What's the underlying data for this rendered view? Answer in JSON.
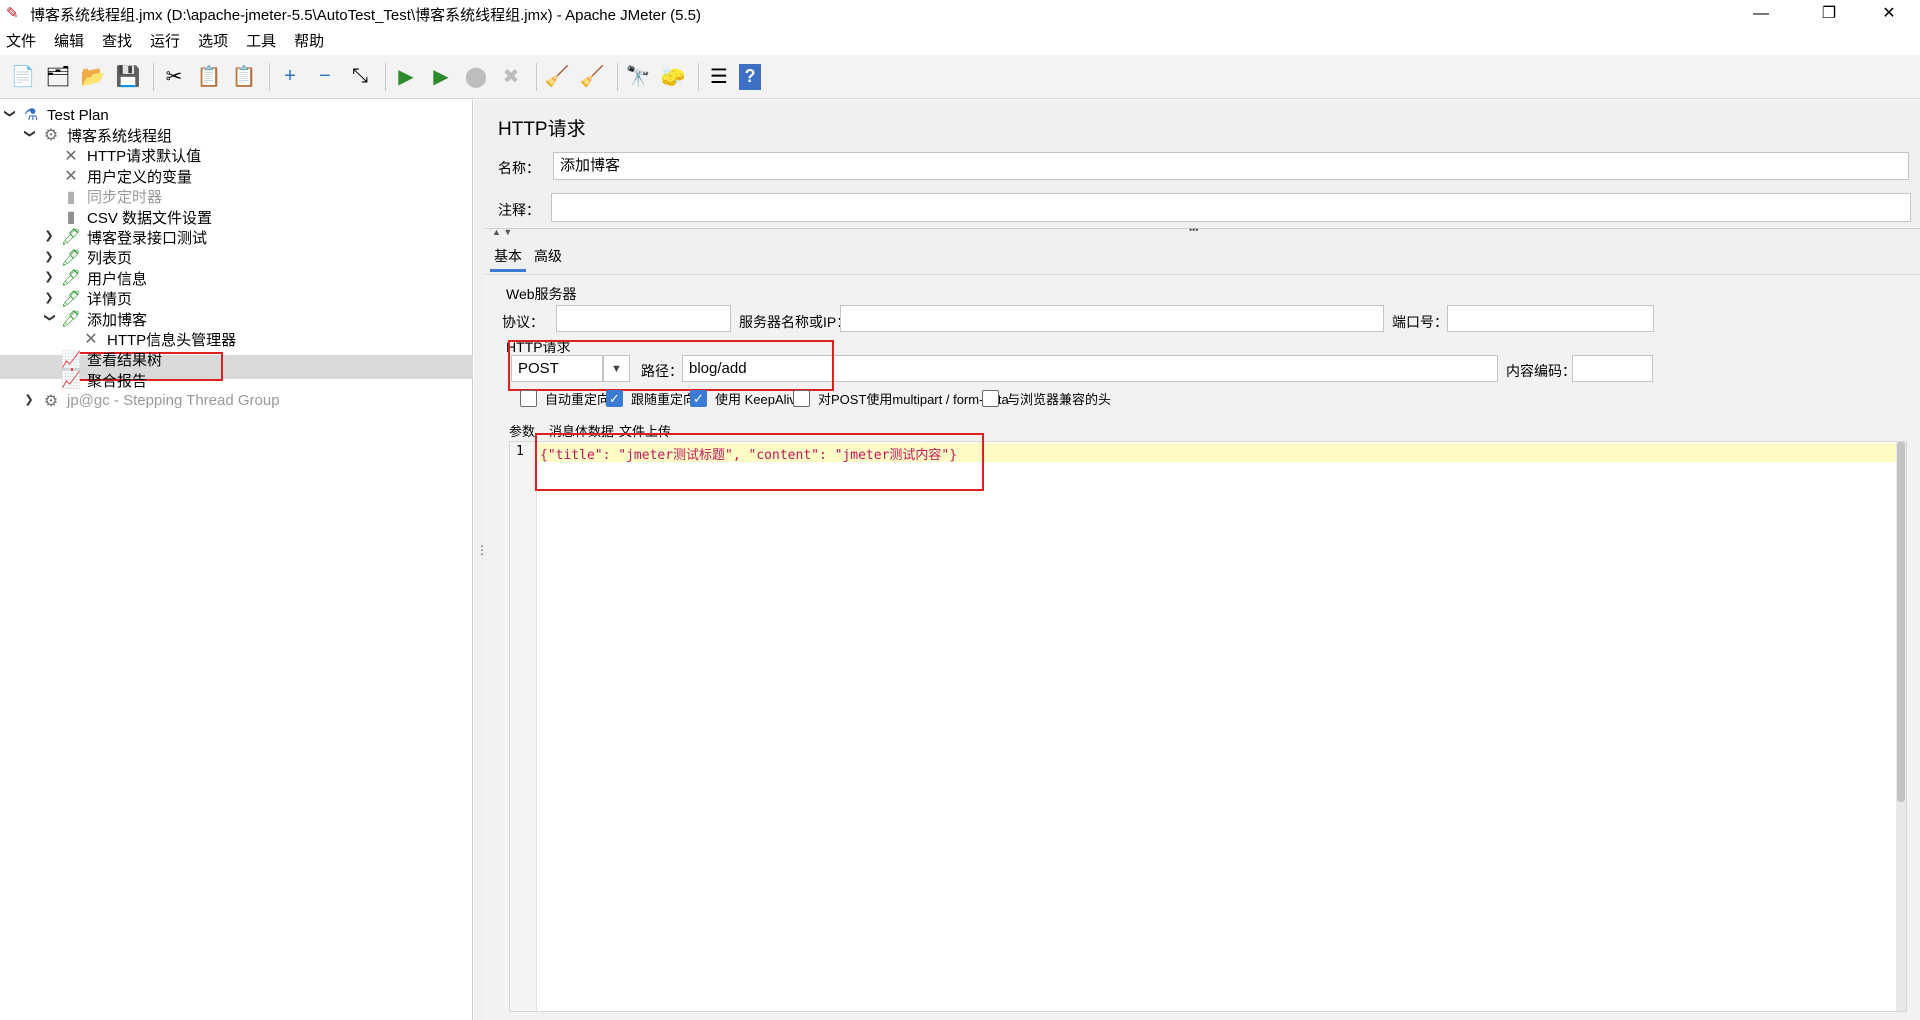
{
  "window": {
    "title": "博客系统线程组.jmx (D:\\apache-jmeter-5.5\\AutoTest_Test\\博客系统线程组.jmx) - Apache JMeter (5.5)",
    "minimize": "—",
    "restore": "❐",
    "close": "✕"
  },
  "menu": [
    "文件",
    "编辑",
    "查找",
    "运行",
    "选项",
    "工具",
    "帮助"
  ],
  "toolbar": [
    {
      "name": "new-icon",
      "glyph": "📄"
    },
    {
      "name": "templates-icon",
      "glyph": "🗂"
    },
    {
      "name": "open-icon",
      "glyph": "📂"
    },
    {
      "name": "save-icon",
      "glyph": "💾"
    },
    {
      "name": "cut-icon",
      "glyph": "✂"
    },
    {
      "name": "copy-icon",
      "glyph": "📋"
    },
    {
      "name": "paste-icon",
      "glyph": "📋"
    },
    {
      "name": "expand-icon",
      "glyph": "+"
    },
    {
      "name": "collapse-icon",
      "glyph": "−"
    },
    {
      "name": "toggle-icon",
      "glyph": "⤡"
    },
    {
      "name": "start-icon",
      "glyph": "▶"
    },
    {
      "name": "start-no-pause-icon",
      "glyph": "▶"
    },
    {
      "name": "stop-icon",
      "glyph": "⬤"
    },
    {
      "name": "shutdown-icon",
      "glyph": "✖"
    },
    {
      "name": "clear-icon",
      "glyph": "🧹"
    },
    {
      "name": "clear-all-icon",
      "glyph": "🧹"
    },
    {
      "name": "search-icon",
      "glyph": "🔭"
    },
    {
      "name": "reset-search-icon",
      "glyph": "🧽"
    },
    {
      "name": "function-helper-icon",
      "glyph": "☰"
    },
    {
      "name": "help-icon",
      "glyph": "?"
    }
  ],
  "tree": [
    {
      "label": "Test Plan",
      "icon": "flask-icon",
      "glyph": "⚗",
      "arrow": "⌄",
      "disabled": false
    },
    {
      "label": "博客系统线程组",
      "icon": "gear-icon",
      "glyph": "⚙",
      "arrow": "⌄",
      "disabled": false
    },
    {
      "label": "HTTP请求默认值",
      "icon": "wrench-icon",
      "glyph": "✕",
      "arrow": "",
      "disabled": false
    },
    {
      "label": "用户定义的变量",
      "icon": "wrench-icon",
      "glyph": "✕",
      "arrow": "",
      "disabled": false
    },
    {
      "label": "同步定时器",
      "icon": "timer-icon",
      "glyph": "▮",
      "arrow": "",
      "disabled": true
    },
    {
      "label": "CSV 数据文件设置",
      "icon": "file-icon",
      "glyph": "▮",
      "arrow": "",
      "disabled": false
    },
    {
      "label": "博客登录接口测试",
      "icon": "sampler-icon",
      "glyph": "🖊",
      "arrow": "›",
      "disabled": false
    },
    {
      "label": "列表页",
      "icon": "sampler-icon",
      "glyph": "🖊",
      "arrow": "›",
      "disabled": false
    },
    {
      "label": "用户信息",
      "icon": "sampler-icon",
      "glyph": "🖊",
      "arrow": "›",
      "disabled": false
    },
    {
      "label": "详情页",
      "icon": "sampler-icon",
      "glyph": "🖊",
      "arrow": "›",
      "disabled": false
    },
    {
      "label": "添加博客",
      "icon": "sampler-icon",
      "glyph": "🖊",
      "arrow": "⌄",
      "disabled": false
    },
    {
      "label": "HTTP信息头管理器",
      "icon": "wrench-icon",
      "glyph": "✕",
      "arrow": "",
      "disabled": false
    },
    {
      "label": "查看结果树",
      "icon": "listener-icon",
      "glyph": "📈",
      "arrow": "",
      "disabled": false
    },
    {
      "label": "聚合报告",
      "icon": "listener-icon",
      "glyph": "📈",
      "arrow": "",
      "disabled": false
    },
    {
      "label": "jp@gc - Stepping Thread Group",
      "icon": "gear-icon",
      "glyph": "⚙",
      "arrow": "›",
      "disabled": true
    }
  ],
  "panel": {
    "heading": "HTTP请求",
    "name_label": "名称：",
    "name_value": "添加博客",
    "comment_label": "注释：",
    "comment_value": "",
    "tabs": [
      "基本",
      "高级"
    ],
    "web_server_title": "Web服务器",
    "protocol_label": "协议：",
    "server_label": "服务器名称或IP：",
    "port_label": "端口号：",
    "http_request_title": "HTTP请求",
    "method": "POST",
    "path_label": "路径：",
    "path_value": "blog/add",
    "encoding_label": "内容编码：",
    "checkboxes": [
      {
        "label": "自动重定向",
        "checked": false
      },
      {
        "label": "跟随重定向",
        "checked": true
      },
      {
        "label": "使用 KeepAlive",
        "checked": true
      },
      {
        "label": "对POST使用multipart / form-data",
        "checked": false
      },
      {
        "label": "与浏览器兼容的头",
        "checked": false
      }
    ],
    "body_tabs": [
      "参数",
      "消息体数据",
      "文件上传"
    ],
    "line_number": "1",
    "body_text": "{\"title\": \"jmeter测试标题\", \"content\": \"jmeter测试内容\"}"
  }
}
